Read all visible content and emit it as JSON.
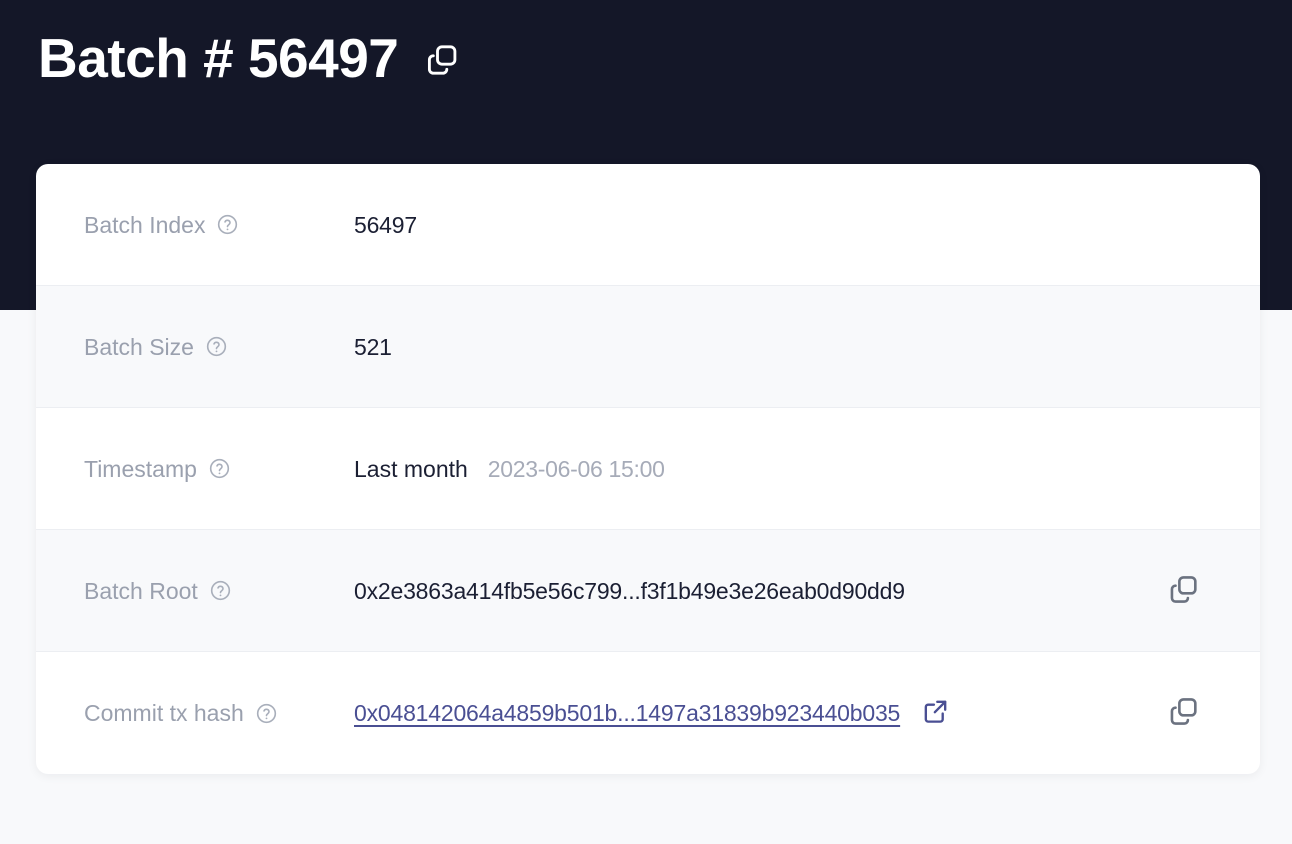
{
  "header": {
    "title": "Batch # 56497",
    "copy_icon": "copy-icon"
  },
  "colors": {
    "header_bg": "#141728",
    "page_bg": "#f8f9fb",
    "card_bg": "#ffffff",
    "row_alt_bg": "#f8f9fb",
    "label": "#9aa0ae",
    "value": "#1b1f33",
    "link": "#4a4f93",
    "muted": "#a6abb8",
    "icon_gray": "#6b7280"
  },
  "card": {
    "rows": [
      {
        "label": "Batch Index",
        "help_icon": "help-circle-icon",
        "value": "56497",
        "type": "text",
        "has_copy": false
      },
      {
        "label": "Batch Size",
        "help_icon": "help-circle-icon",
        "value": "521",
        "type": "text",
        "has_copy": false
      },
      {
        "label": "Timestamp",
        "help_icon": "help-circle-icon",
        "value_relative": "Last month",
        "value_absolute": "2023-06-06 15:00",
        "type": "timestamp",
        "has_copy": false
      },
      {
        "label": "Batch Root",
        "help_icon": "help-circle-icon",
        "value": "0x2e3863a414fb5e56c799...f3f1b49e3e26eab0d90dd9",
        "type": "hash",
        "has_copy": true,
        "copy_icon": "copy-icon"
      },
      {
        "label": "Commit tx hash",
        "help_icon": "help-circle-icon",
        "value": "0x048142064a4859b501b...1497a31839b923440b035",
        "type": "link",
        "external_icon": "external-link-icon",
        "has_copy": true,
        "copy_icon": "copy-icon"
      }
    ]
  }
}
